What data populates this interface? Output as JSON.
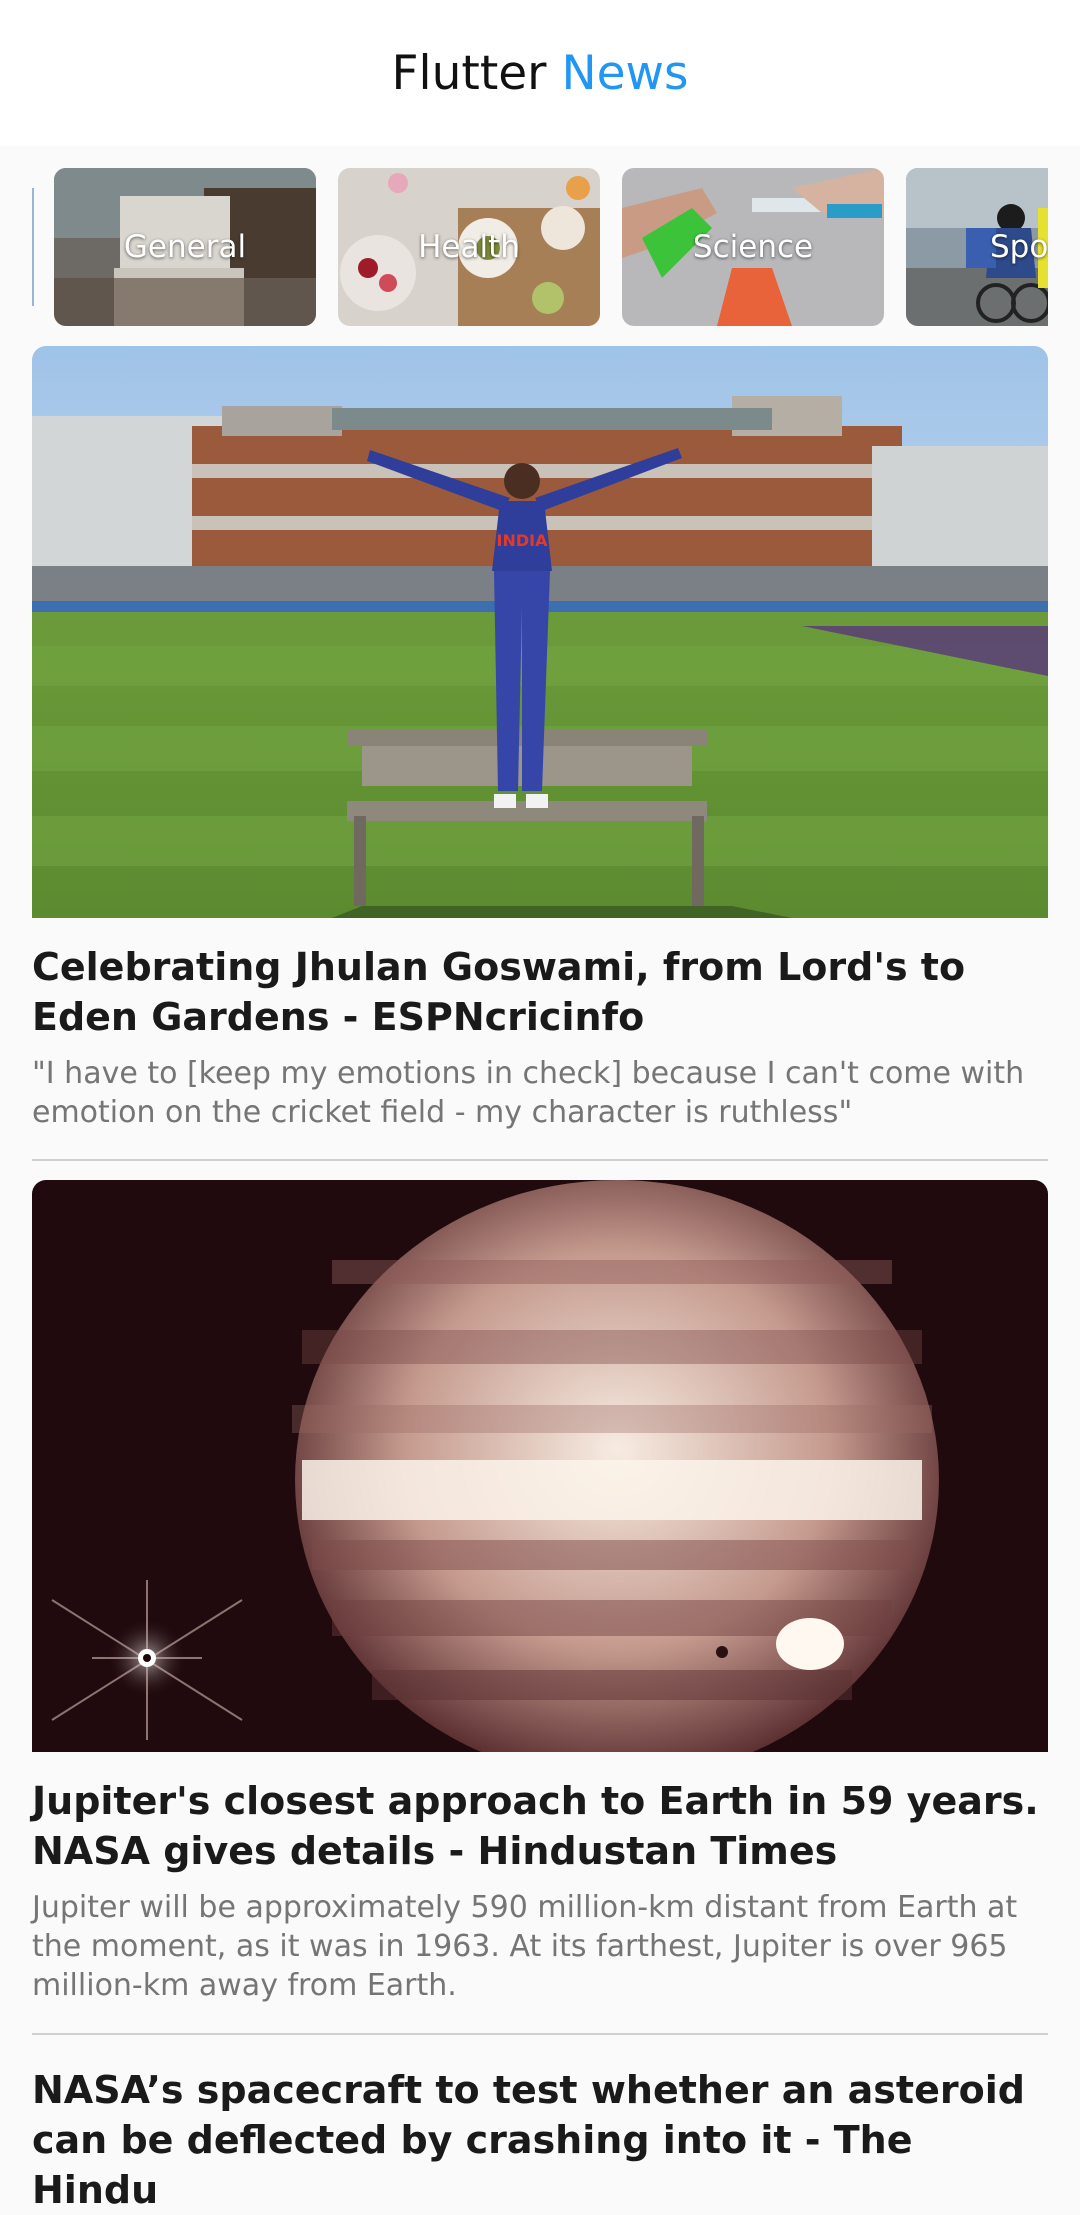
{
  "app": {
    "title_main": "Flutter",
    "title_accent": "News",
    "accent_color": "#2196f3"
  },
  "categories": [
    {
      "label": "General"
    },
    {
      "label": "Health"
    },
    {
      "label": "Science"
    },
    {
      "label": "Sports"
    }
  ],
  "articles": [
    {
      "headline": "Celebrating Jhulan Goswami, from Lord's to Eden Gardens - ESPNcricinfo",
      "description": "\"I have to [keep my emotions in check] because I can't come with emotion on the cricket field - my character is ruthless\"",
      "jersey_text": "INDIA"
    },
    {
      "headline": "Jupiter's closest approach to Earth in 59 years. NASA gives details - Hindustan Times",
      "description": "Jupiter will be approximately 590 million-km distant from Earth at the moment, as it was in 1963. At its farthest, Jupiter is over 965 million-km away from Earth."
    },
    {
      "headline": "NASA’s spacecraft to test whether an asteroid can be deflected by crashing into it - The Hindu"
    }
  ]
}
